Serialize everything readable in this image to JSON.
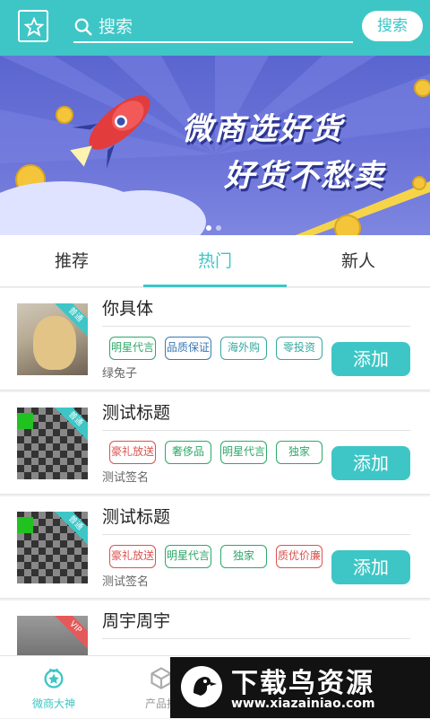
{
  "header": {
    "search_placeholder": "搜索",
    "search_button": "搜索"
  },
  "banner": {
    "line1": "微商选好货",
    "line2": "好货不愁卖"
  },
  "tabs": [
    {
      "label": "推荐"
    },
    {
      "label": "热门"
    },
    {
      "label": "新人"
    }
  ],
  "items": [
    {
      "title": "你具体",
      "ribbon": "普通",
      "tags": [
        "明星代言",
        "品质保证",
        "海外购",
        "零投资"
      ],
      "signature": "绿兔子",
      "add_label": "添加"
    },
    {
      "title": "测试标题",
      "ribbon": "普通",
      "tags": [
        "豪礼放送",
        "奢侈品",
        "明星代言",
        "独家"
      ],
      "signature": "测试签名",
      "add_label": "添加"
    },
    {
      "title": "测试标题",
      "ribbon": "普通",
      "tags": [
        "豪礼放送",
        "明星代言",
        "独家",
        "质优价廉"
      ],
      "signature": "测试签名",
      "add_label": "添加"
    },
    {
      "title": "周宇周宇",
      "ribbon": "VIP"
    }
  ],
  "bottom_nav": [
    {
      "label": "微商大神"
    },
    {
      "label": "产品推"
    }
  ],
  "watermark": {
    "title": "下载鸟资源",
    "url": "www.xiazainiao.com"
  },
  "colors": {
    "accent": "#3ec6c6",
    "banner": "#6b73d8",
    "tag_green": "#2da86a",
    "tag_blue": "#3a78b5",
    "tag_red": "#d9534f"
  }
}
